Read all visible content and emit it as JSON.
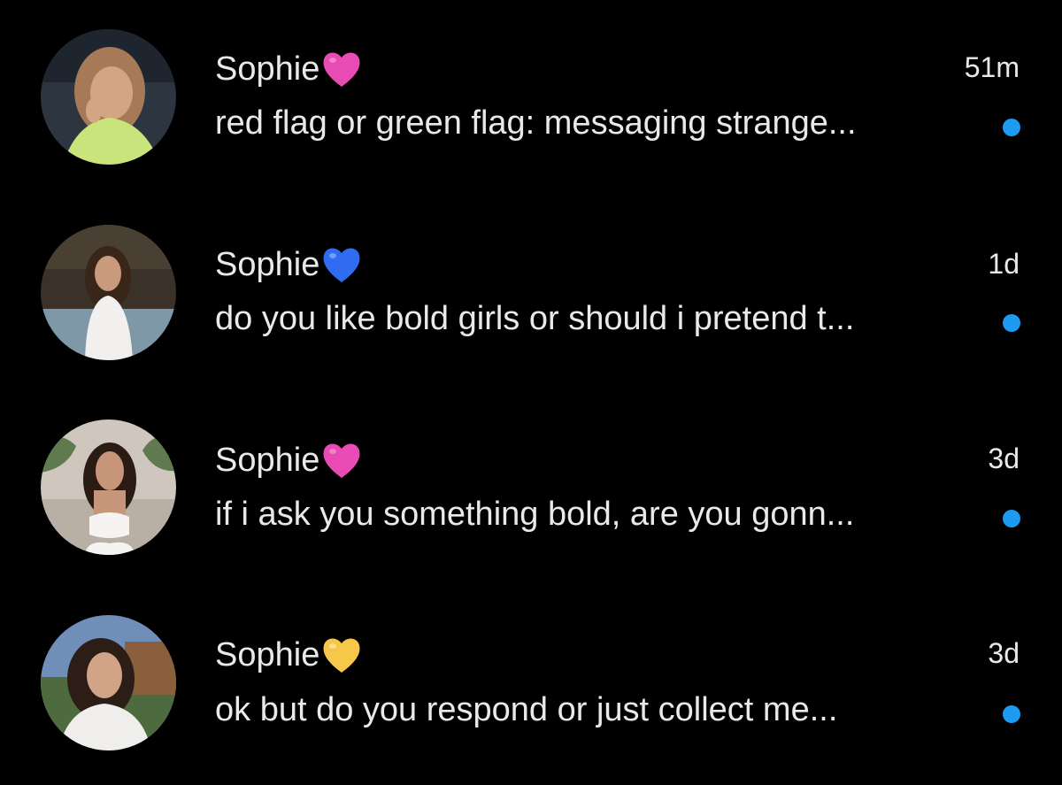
{
  "conversations": [
    {
      "name": "Sophie",
      "heart_emoji": "pink-heart",
      "heart_color": "#e94bb4",
      "time": "51m",
      "preview": "red flag or green flag: messaging strange...",
      "unread": true,
      "avatar_colors": {
        "bg": "#2d3540",
        "skin": "#d3a585",
        "hair": "#a67a56",
        "shirt": "#c8e47a"
      }
    },
    {
      "name": "Sophie",
      "heart_emoji": "blue-heart",
      "heart_color": "#2f6cf2",
      "time": "1d",
      "preview": "do you like bold girls or should i pretend t...",
      "unread": true,
      "avatar_colors": {
        "bg": "#3a3129",
        "skin": "#c99a7c",
        "hair": "#3a2618",
        "shirt": "#f2f0ee"
      }
    },
    {
      "name": "Sophie",
      "heart_emoji": "pink-heart",
      "heart_color": "#e94bb4",
      "time": "3d",
      "preview": "if i ask you something bold, are you gonn...",
      "unread": true,
      "avatar_colors": {
        "bg": "#cfc7bd",
        "skin": "#c6957a",
        "hair": "#2a1c14",
        "shirt": "#f6f4f2"
      }
    },
    {
      "name": "Sophie",
      "heart_emoji": "yellow-heart",
      "heart_color": "#f7c74a",
      "time": "3d",
      "preview": "ok but do you respond or just collect me...",
      "unread": true,
      "avatar_colors": {
        "bg": "#6f8fb8",
        "skin": "#d1a488",
        "hair": "#2c1e16",
        "shirt": "#efeeec"
      }
    }
  ],
  "theme": {
    "background": "#000000",
    "text": "#e7e9ea",
    "unread_dot": "#1d9bf0"
  }
}
